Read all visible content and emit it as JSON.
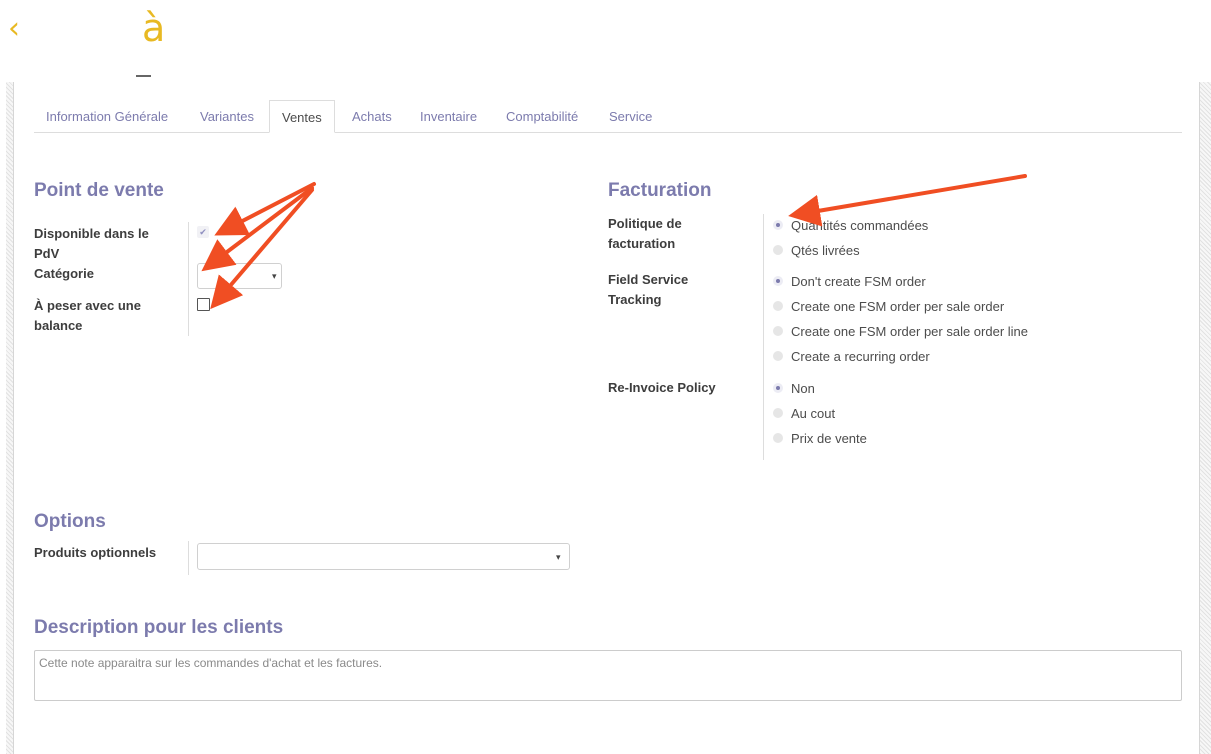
{
  "header": {
    "back_icon": "‹",
    "accent_char": "à"
  },
  "tabs": [
    {
      "label": "Information Générale",
      "active": false
    },
    {
      "label": "Variantes",
      "active": false
    },
    {
      "label": "Ventes",
      "active": true
    },
    {
      "label": "Achats",
      "active": false
    },
    {
      "label": "Inventaire",
      "active": false
    },
    {
      "label": "Comptabilité",
      "active": false
    },
    {
      "label": "Service",
      "active": false
    }
  ],
  "pos": {
    "title": "Point de vente",
    "available_label": "Disponible dans le PdV",
    "available_checked": true,
    "category_label": "Catégorie",
    "category_value": "",
    "weigh_label": "À peser avec une balance",
    "weigh_checked": false
  },
  "billing": {
    "title": "Facturation",
    "policy_label": "Politique de facturation",
    "policy_options": [
      "Quantités commandées",
      "Qtés livrées"
    ],
    "policy_selected": 0,
    "fsm_label": "Field Service Tracking",
    "fsm_options": [
      "Don't create FSM order",
      "Create one FSM order per sale order",
      "Create one FSM order per sale order line",
      "Create a recurring order"
    ],
    "fsm_selected": 0,
    "reinvoice_label": "Re-Invoice Policy",
    "reinvoice_options": [
      "Non",
      "Au cout",
      "Prix de vente"
    ],
    "reinvoice_selected": 0
  },
  "options": {
    "title": "Options",
    "optional_products_label": "Produits optionnels",
    "optional_products_value": ""
  },
  "description": {
    "title": "Description pour les clients",
    "placeholder": "Cette note apparaitra sur les commandes d'achat et les factures."
  },
  "colors": {
    "accent": "#7c7bad",
    "annotation_arrow": "#f04e23",
    "header_accent": "#e8b923"
  }
}
